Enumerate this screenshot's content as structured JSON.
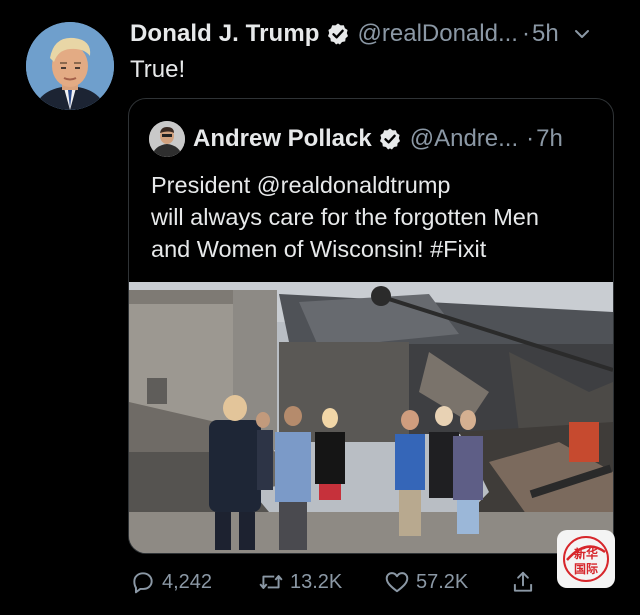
{
  "tweet": {
    "author": {
      "display_name": "Donald J. Trump",
      "handle": "@realDonald...",
      "verified": true
    },
    "separator": "·",
    "time": "5h",
    "text": "True!",
    "menu_icon": "chevron-down-icon"
  },
  "quoted_tweet": {
    "author": {
      "display_name": "Andrew Pollack",
      "handle": "@Andre...",
      "verified": true
    },
    "separator": "·",
    "time": "7h",
    "text_lines": [
      "President @realdonaldtrump",
      "will always care for the forgotten Men",
      "and Women of Wisconsin! #Fixit"
    ],
    "media": "photo-damaged-buildings-group"
  },
  "actions": {
    "reply": {
      "icon": "reply-icon",
      "count": "4,242"
    },
    "retweet": {
      "icon": "retweet-icon",
      "count": "13.2K"
    },
    "like": {
      "icon": "heart-icon",
      "count": "57.2K"
    },
    "share": {
      "icon": "share-icon"
    }
  },
  "watermark": {
    "text_top": "新华",
    "text_bottom": "国际"
  },
  "colors": {
    "background": "#000000",
    "primary_text": "#e7e9ea",
    "secondary_text": "#8b98a5",
    "border": "#2f3336",
    "verified_badge": "#e7e9ea",
    "watermark_red": "#d7262b"
  }
}
